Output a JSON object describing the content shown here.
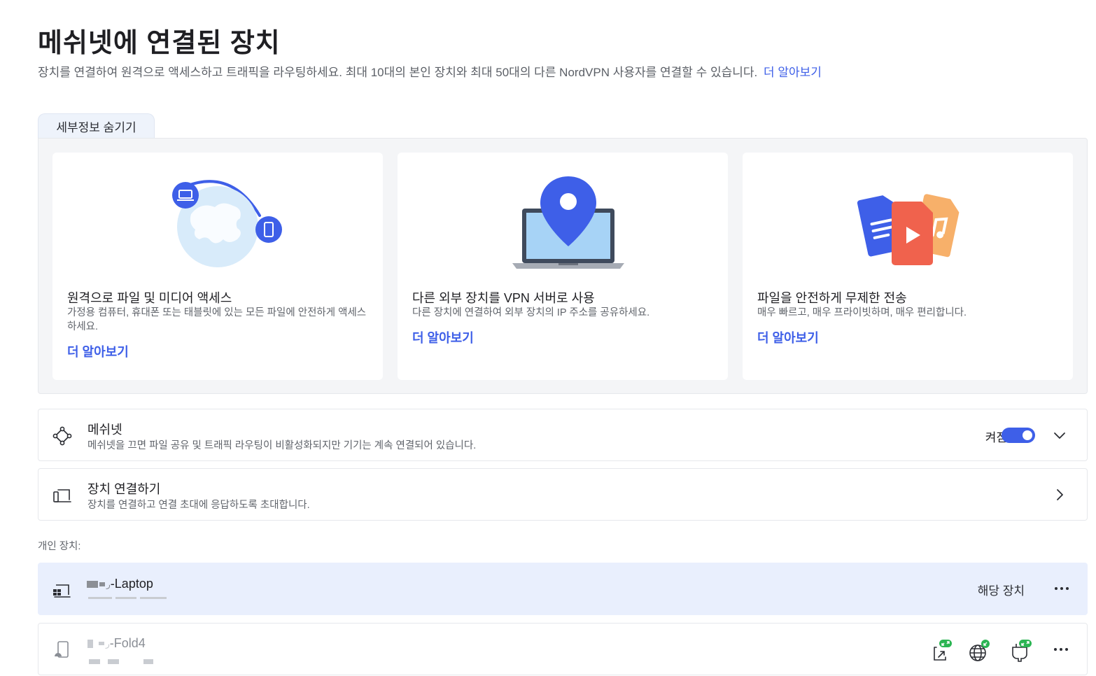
{
  "header": {
    "title": "메쉬넷에 연결된 장치",
    "description": "장치를 연결하여 원격으로 액세스하고 트래픽을 라우팅하세요. 최대 10대의 본인 장치와 최대 50대의 다른 NordVPN 사용자를 연결할 수 있습니다.",
    "learn_more": "더 알아보기"
  },
  "details_tab": {
    "label": "세부정보 숨기기"
  },
  "features": [
    {
      "title": "원격으로 파일 및 미디어 액세스",
      "description": "가정용 컴퓨터, 휴대폰 또는 태블릿에 있는 모든 파일에 안전하게 액세스하세요.",
      "learn_more": "더 알아보기",
      "icon": "globe-devices-illustration"
    },
    {
      "title": "다른 외부 장치를 VPN 서버로 사용",
      "description": "다른 장치에 연결하여 외부 장치의 IP 주소를 공유하세요.",
      "learn_more": "더 알아보기",
      "icon": "laptop-pin-illustration"
    },
    {
      "title": "파일을 안전하게 무제한 전송",
      "description": "매우 빠르고, 매우 프라이빗하며, 매우 편리합니다.",
      "learn_more": "더 알아보기",
      "icon": "files-illustration"
    }
  ],
  "meshnet": {
    "title": "메쉬넷",
    "subtitle": "메쉬넷을 끄면 파일 공유 및 트래픽 라우팅이 비활성화되지만 기기는 계속 연결되어 있습니다.",
    "toggle_label": "켜짐",
    "enabled": true,
    "icon": "mesh-nodes-icon"
  },
  "link_device": {
    "title": "장치 연결하기",
    "subtitle": "장치를 연결하고 연결 초대에 응답하도록 초대합니다.",
    "icon": "link-devices-icon"
  },
  "personal_devices": {
    "label": "개인 장치:",
    "devices": [
      {
        "name_suffix": "-Laptop",
        "badge": "해당 장치",
        "current": true,
        "icon": "windows-laptop-icon"
      },
      {
        "name_suffix": "-Fold4",
        "current": false,
        "icon": "android-phone-icon",
        "permissions": [
          "file-sharing-icon",
          "traffic-routing-icon",
          "local-network-icon"
        ]
      }
    ]
  },
  "colors": {
    "accent": "#3e5fe8",
    "current_row": "#e9effd",
    "panel": "#f4f5f7",
    "tab": "#eef3fb",
    "perm_badge": "#2bb553"
  }
}
